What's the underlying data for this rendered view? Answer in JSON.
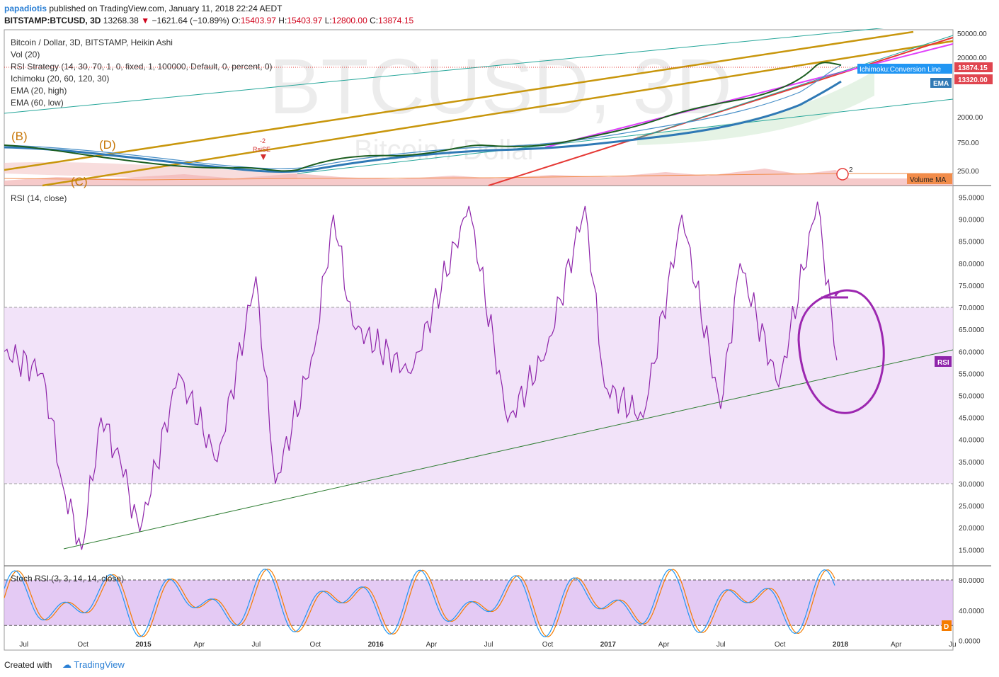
{
  "header": {
    "author": "papadiotis",
    "published": "published on TradingView.com, January 11, 2018 22:24 AEDT",
    "symbol": "BITSTAMP:BTCUSD, 3D",
    "last": "13268.38",
    "change_arrow": "▼",
    "change": "−1621.64 (−10.89%)",
    "ohlc_o_label": "O:",
    "ohlc_o": "15403.97",
    "ohlc_h_label": "H:",
    "ohlc_h": "15403.97",
    "ohlc_l_label": "L:",
    "ohlc_l": "12800.00",
    "ohlc_c_label": "C:",
    "ohlc_c": "13874.15"
  },
  "price_pane": {
    "legend": [
      "Bitcoin / Dollar, 3D, BITSTAMP, Heikin Ashi",
      "Vol (20)",
      "RSI Strategy (14, 30, 70, 1, 0, fixed, 1, 100000, Default, 0, percent, 0)",
      "Ichimoku (20, 60, 120, 30)",
      "EMA (20, high)",
      "EMA (60, low)"
    ],
    "watermark_big": "BTCUSD, 3D",
    "watermark_small": "Bitcoin / Dollar",
    "wave_labels": [
      "(B)",
      "(D)",
      "(C)"
    ],
    "signal_labels": [
      "-2",
      "RsiSE"
    ],
    "axis_ticks": [
      "50000.00",
      "20000.00",
      "13874.15",
      "13320.00",
      "2000.00",
      "750.00",
      "250.00"
    ],
    "tag_conversion": "Ichimoku:Conversion Line",
    "tag_ema": "EMA",
    "tag_volume": "Volume MA",
    "events_badge": "2",
    "colors": {
      "price_tag": "#e0454f",
      "ema_tag": "#2f79b5",
      "conv_tag": "#2196f3",
      "volume_tag": "#f28c4a"
    }
  },
  "rsi_pane": {
    "title": "RSI (14, close)",
    "tag": "RSI",
    "axis_ticks": [
      "95.0000",
      "90.0000",
      "85.0000",
      "80.0000",
      "75.0000",
      "70.0000",
      "65.0000",
      "60.0000",
      "55.0000",
      "50.0000",
      "45.0000",
      "40.0000",
      "35.0000",
      "30.0000",
      "25.0000",
      "20.0000",
      "15.0000"
    ],
    "line_color": "#8e24aa",
    "band_color": "#ecd7f7"
  },
  "stoch_pane": {
    "title": "Stoch RSI (3, 3, 14, 14, close)",
    "tag": "D",
    "axis_ticks": [
      "80.0000",
      "40.0000",
      "0.0000"
    ],
    "k_color": "#2196f3",
    "d_color": "#f57c00"
  },
  "time_axis": [
    "Jul",
    "Oct",
    "2015",
    "Apr",
    "Jul",
    "Oct",
    "2016",
    "Apr",
    "Jul",
    "Oct",
    "2017",
    "Apr",
    "Jul",
    "Oct",
    "2018",
    "Apr",
    "Ju"
  ],
  "footer": {
    "created": "Created with",
    "brand": "TradingView"
  },
  "chart_data": {
    "type": "line",
    "title": "Bitcoin / Dollar, 3D, BITSTAMP, Heikin Ashi",
    "series": [
      {
        "name": "RSI (14, close)",
        "x_dates": [
          "2014-06",
          "2014-08",
          "2014-09",
          "2014-10",
          "2014-11",
          "2014-12",
          "2015-01",
          "2015-03",
          "2015-05",
          "2015-07",
          "2015-08",
          "2015-10",
          "2015-11",
          "2015-12",
          "2016-03",
          "2016-06",
          "2016-08",
          "2016-10",
          "2016-12",
          "2017-01",
          "2017-03",
          "2017-05",
          "2017-07",
          "2017-08",
          "2017-10",
          "2017-12",
          "2018-01"
        ],
        "values": [
          60,
          55,
          30,
          15,
          45,
          35,
          19,
          55,
          35,
          77,
          30,
          60,
          91,
          66,
          55,
          93,
          44,
          60,
          93,
          52,
          45,
          91,
          47,
          80,
          52,
          94,
          58
        ]
      }
    ],
    "rsi_levels": {
      "upper": 70,
      "lower": 30
    },
    "ylim_rsi": [
      12,
      97
    ],
    "stoch_levels": {
      "upper": 80,
      "lower": 20
    },
    "ylim_stoch": [
      -5,
      95
    ],
    "price_last": 13874.15,
    "ema_last": 13320.0
  }
}
